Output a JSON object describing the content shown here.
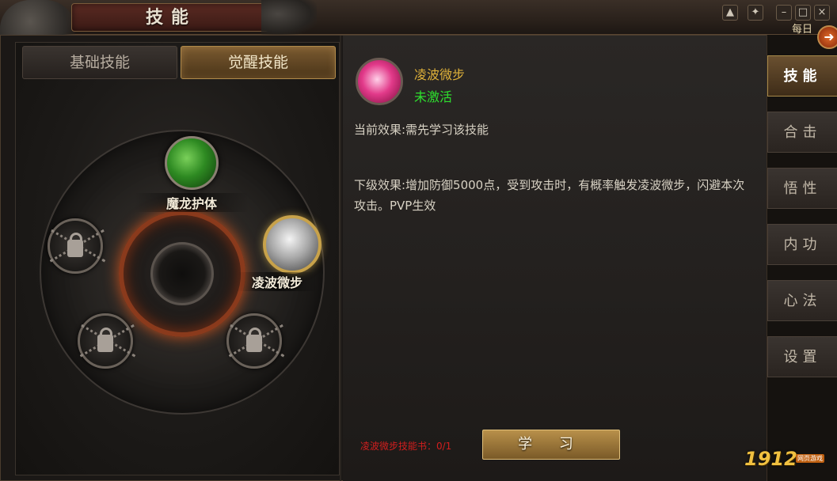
{
  "window": {
    "title": "技能",
    "daily_label": "每日"
  },
  "tabs": {
    "basic": "基础技能",
    "awaken": "觉醒技能"
  },
  "wheel": {
    "skill_top": "魔龙护体",
    "skill_right": "凌波微步"
  },
  "detail": {
    "name": "凌波微步",
    "status": "未激活",
    "current_effect": "当前效果:需先学习该技能",
    "next_effect": "下级效果:增加防御5000点，受到攻击时，有概率触发凌波微步，闪避本次攻击。PVP生效",
    "book_count": "凌波微步技能书：0/1",
    "learn_button": "学 习"
  },
  "side_menu": {
    "items": [
      "技能",
      "合击",
      "悟性",
      "内功",
      "心法",
      "设置"
    ]
  },
  "logo": {
    "text": "1912",
    "sub": "网页游戏"
  },
  "colors": {
    "accent_gold": "#e0b23a",
    "status_green": "#2ee02e",
    "warning_red": "#d21e1e"
  },
  "icons": [
    "shirt-icon",
    "pin-icon",
    "minimize-icon",
    "maximize-icon",
    "close-icon",
    "lock-icon"
  ]
}
